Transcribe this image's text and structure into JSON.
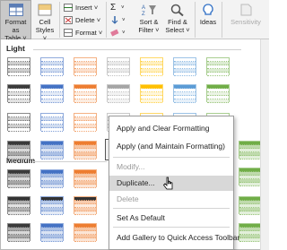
{
  "ribbon": {
    "format_as_table": [
      "Format as",
      "Table ˅"
    ],
    "cell_styles": [
      "Cell",
      "Styles ˅"
    ],
    "insert": "Insert ˅",
    "delete": "Delete ˅",
    "format": "Format ˅",
    "sort_filter": [
      "Sort &",
      "Filter ˅"
    ],
    "find_select": [
      "Find &",
      "Select ˅"
    ],
    "ideas": "Ideas",
    "sensitivity": "Sensitivity"
  },
  "gallery": {
    "section_light": "Light",
    "section_medium": "Medium"
  },
  "context_menu": {
    "items": [
      {
        "label": "Apply and Clear Formatting",
        "disabled": false
      },
      {
        "label": "Apply (and Maintain Formatting)",
        "disabled": false
      },
      {
        "label": "Modify...",
        "disabled": true
      },
      {
        "label": "Duplicate...",
        "disabled": false,
        "highlighted": true
      },
      {
        "label": "Delete",
        "disabled": true
      },
      {
        "label": "Set As Default",
        "disabled": false
      },
      {
        "label": "Add Gallery to Quick Access Toolbar",
        "disabled": false
      }
    ]
  },
  "colors": {
    "black": "#3a3a3a",
    "blue": "#4472c4",
    "orange": "#ed7d31",
    "gray": "#a5a5a5",
    "gold": "#ffc000",
    "lightblue": "#5b9bd5",
    "green": "#70ad47"
  }
}
